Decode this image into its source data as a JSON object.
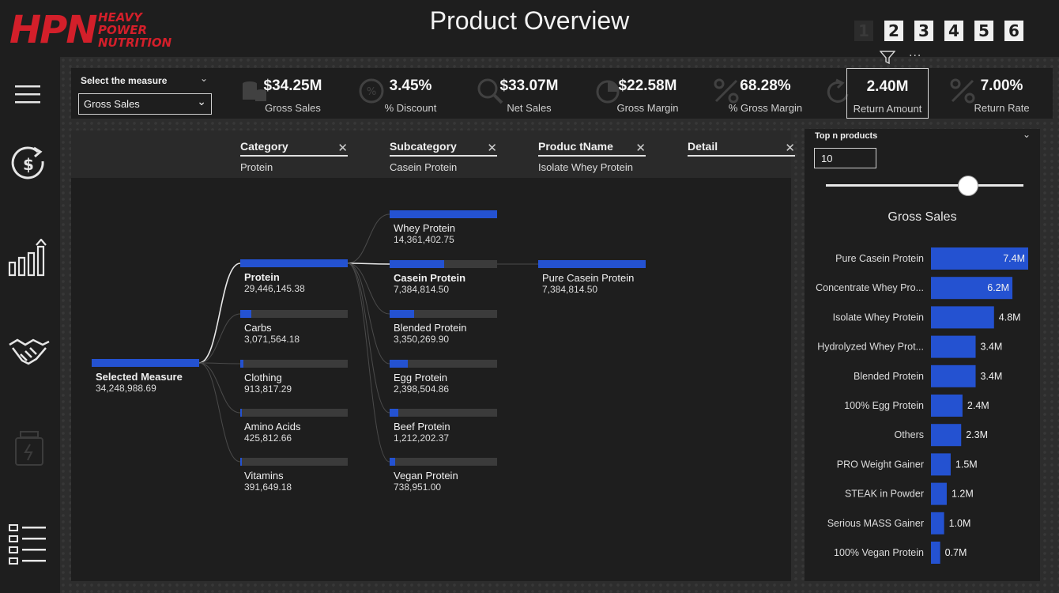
{
  "logo": {
    "main": "HPN",
    "sub_lines": [
      "HEAVY",
      "POWER",
      "NUTRITION"
    ]
  },
  "title": "Product Overview",
  "page_nav": [
    "1",
    "2",
    "3",
    "4",
    "5",
    "6"
  ],
  "active_page": "1",
  "more_label": "···",
  "left_nav": [
    "menu-icon",
    "finance-icon",
    "growth-chart-icon",
    "handshake-icon",
    "supplement-jar-icon",
    "list-icon"
  ],
  "measure_selector": {
    "label": "Select the measure",
    "value": "Gross Sales"
  },
  "kpis": [
    {
      "value": "$34.25M",
      "label": "Gross Sales",
      "icon": "coins-icon"
    },
    {
      "value": "3.45%",
      "label": "% Discount",
      "icon": "discount-gear-icon"
    },
    {
      "value": "$33.07M",
      "label": "Net Sales",
      "icon": "money-search-icon"
    },
    {
      "value": "$22.58M",
      "label": "Gross Margin",
      "icon": "pie-icon"
    },
    {
      "value": "68.28%",
      "label": "% Gross Margin",
      "icon": "percent-icon"
    },
    {
      "value": "2.40M",
      "label": "Return Amount",
      "icon": "return-icon"
    },
    {
      "value": "7.00%",
      "label": "Return Rate",
      "icon": "percent-icon"
    }
  ],
  "selected_kpi": "Return Amount",
  "tree": {
    "columns": [
      {
        "title": "Category",
        "sub": "Protein",
        "closable": true
      },
      {
        "title": "Subcategory",
        "sub": "Casein Protein",
        "closable": true
      },
      {
        "title": "Produc tName",
        "sub": "Isolate Whey Protein",
        "closable": true
      },
      {
        "title": "Detail",
        "sub": "",
        "closable": true
      }
    ],
    "root": {
      "name": "Selected Measure",
      "value": "34,248,988.69",
      "fill": 1.0
    },
    "level1": [
      {
        "name": "Protein",
        "value": "29,446,145.38",
        "fill": 1.0,
        "selected": true
      },
      {
        "name": "Carbs",
        "value": "3,071,564.18",
        "fill": 0.1
      },
      {
        "name": "Clothing",
        "value": "913,817.29",
        "fill": 0.03
      },
      {
        "name": "Amino Acids",
        "value": "425,812.66",
        "fill": 0.015
      },
      {
        "name": "Vitamins",
        "value": "391,649.18",
        "fill": 0.013
      }
    ],
    "level2": [
      {
        "name": "Whey Protein",
        "value": "14,361,402.75",
        "fill": 1.0
      },
      {
        "name": "Casein Protein",
        "value": "7,384,814.50",
        "fill": 0.51,
        "selected": true
      },
      {
        "name": "Blended Protein",
        "value": "3,350,269.90",
        "fill": 0.23
      },
      {
        "name": "Egg Protein",
        "value": "2,398,504.86",
        "fill": 0.17
      },
      {
        "name": "Beef Protein",
        "value": "1,212,202.37",
        "fill": 0.08
      },
      {
        "name": "Vegan Protein",
        "value": "738,951.00",
        "fill": 0.05
      }
    ],
    "level3": [
      {
        "name": "Pure Casein Protein",
        "value": "7,384,814.50",
        "fill": 1.0
      }
    ]
  },
  "topn": {
    "label": "Top n products",
    "value": "10",
    "slider_fraction": 0.72
  },
  "chart_data": {
    "type": "bar",
    "orientation": "horizontal",
    "title": "Gross Sales",
    "categories": [
      "Pure Casein Protein",
      "Concentrate Whey Pro...",
      "Isolate Whey Protein",
      "Hydrolyzed Whey Prot...",
      "Blended Protein",
      "100% Egg Protein",
      "Others",
      "PRO Weight Gainer",
      "STEAK in Powder",
      "Serious MASS Gainer",
      "100% Vegan Protein"
    ],
    "values": [
      7.4,
      6.2,
      4.8,
      3.4,
      3.4,
      2.4,
      2.3,
      1.5,
      1.2,
      1.0,
      0.7
    ],
    "labels": [
      "7.4M",
      "6.2M",
      "4.8M",
      "3.4M",
      "3.4M",
      "2.4M",
      "2.3M",
      "1.5M",
      "1.2M",
      "1.0M",
      "0.7M"
    ],
    "bar_color": "#2452d1",
    "xlim": [
      0,
      7.4
    ]
  },
  "colors": {
    "brand": "#d31f2a",
    "bar": "#2452d1",
    "track": "#3b3b3b"
  }
}
